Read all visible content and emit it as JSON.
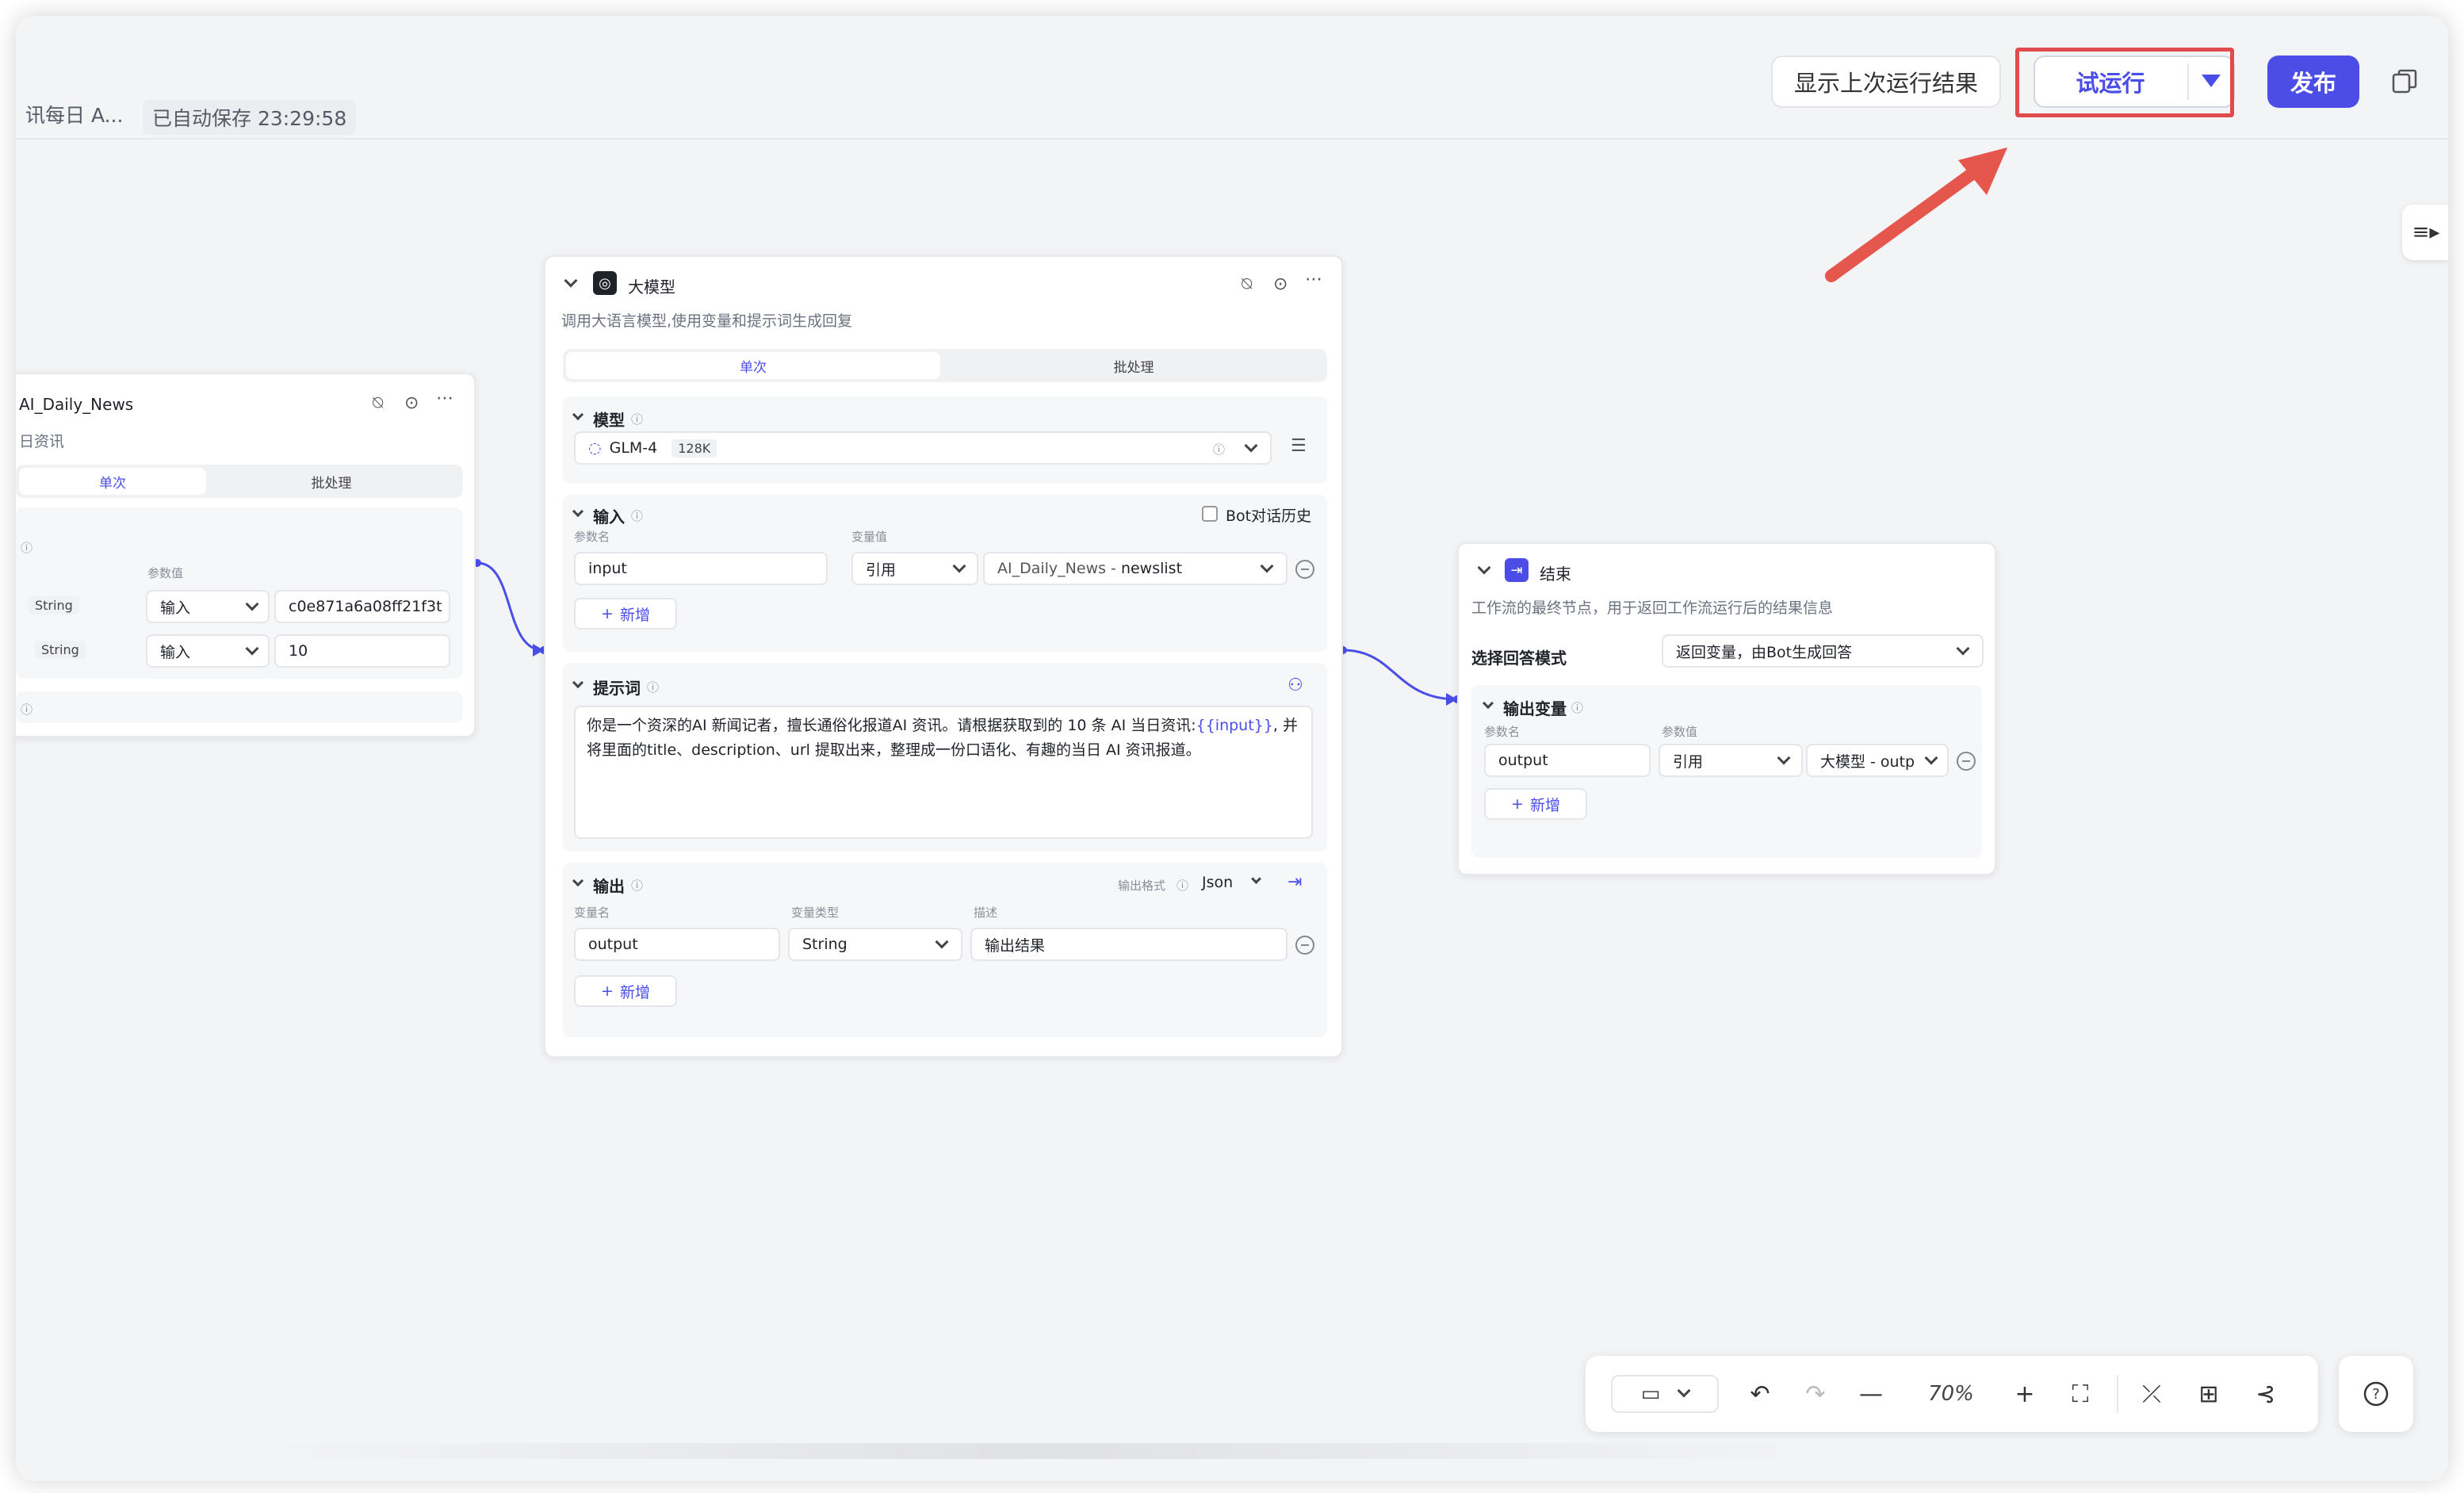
{
  "topbar": {
    "title": "讯每日 A...",
    "autosave": "已自动保存 23:29:58",
    "show_last_result": "显示上次运行结果",
    "test_run": "试运行",
    "publish": "发布"
  },
  "colors": {
    "accent": "#4c4ce6",
    "highlight": "#e04b4b",
    "canvas": "#f3f4f6"
  },
  "start_node": {
    "title": "AI_Daily_News",
    "desc": "日资讯",
    "tab_single": "单次",
    "tab_batch": "批处理",
    "param_value_label": "参数值",
    "rows": [
      {
        "type": "String",
        "mode": "输入",
        "value": "c0e871a6a08ff21f3t"
      },
      {
        "type": "String",
        "mode": "输入",
        "value": "10"
      }
    ]
  },
  "llm_node": {
    "title": "大模型",
    "desc": "调用大语言模型,使用变量和提示词生成回复",
    "tab_single": "单次",
    "tab_batch": "批处理",
    "model_section": "模型",
    "model_name": "GLM-4",
    "model_ctx": "128K",
    "input_section": "输入",
    "bot_history": "Bot对话历史",
    "param_name_label": "参数名",
    "var_value_label": "变量值",
    "input_name": "input",
    "input_mode": "引用",
    "input_ref_prefix": "AI_Daily_News - ",
    "input_ref_var": "newslist",
    "add": "新增",
    "prompt_section": "提示词",
    "prompt_before": "你是一个资深的AI 新闻记者，擅长通俗化报道AI 资讯。请根据获取到的 10 条 AI 当日资讯:",
    "prompt_var": "{{input}}",
    "prompt_after": ", 并将里面的title、description、url 提取出来，整理成一份口语化、有趣的当日 AI 资讯报道。",
    "output_section": "输出",
    "output_format_label": "输出格式",
    "output_format": "Json",
    "var_name_label": "变量名",
    "var_type_label": "变量类型",
    "desc_label": "描述",
    "output_name": "output",
    "output_type": "String",
    "output_desc": "输出结果"
  },
  "end_node": {
    "title": "结束",
    "desc": "工作流的最终节点，用于返回工作流运行后的结果信息",
    "answer_mode_label": "选择回答模式",
    "answer_mode": "返回变量，由Bot生成回答",
    "output_vars": "输出变量",
    "param_name_label": "参数名",
    "param_value_label": "参数值",
    "out_name": "output",
    "out_mode": "引用",
    "out_ref": "大模型 - outp",
    "add": "新增"
  },
  "bottombar": {
    "zoom": "70%"
  },
  "icons": [
    "plugin-off-icon",
    "play-circle-icon",
    "more-icon",
    "chevron-down-icon",
    "info-icon",
    "settings-sliders-icon",
    "undo-icon",
    "redo-icon",
    "zoom-out-icon",
    "zoom-in-icon",
    "fit-view-icon",
    "collapse-icon",
    "layout-icon",
    "pointer-icon",
    "help-icon",
    "copy-icon",
    "panel-toggle-icon",
    "llm-icon",
    "end-icon"
  ]
}
